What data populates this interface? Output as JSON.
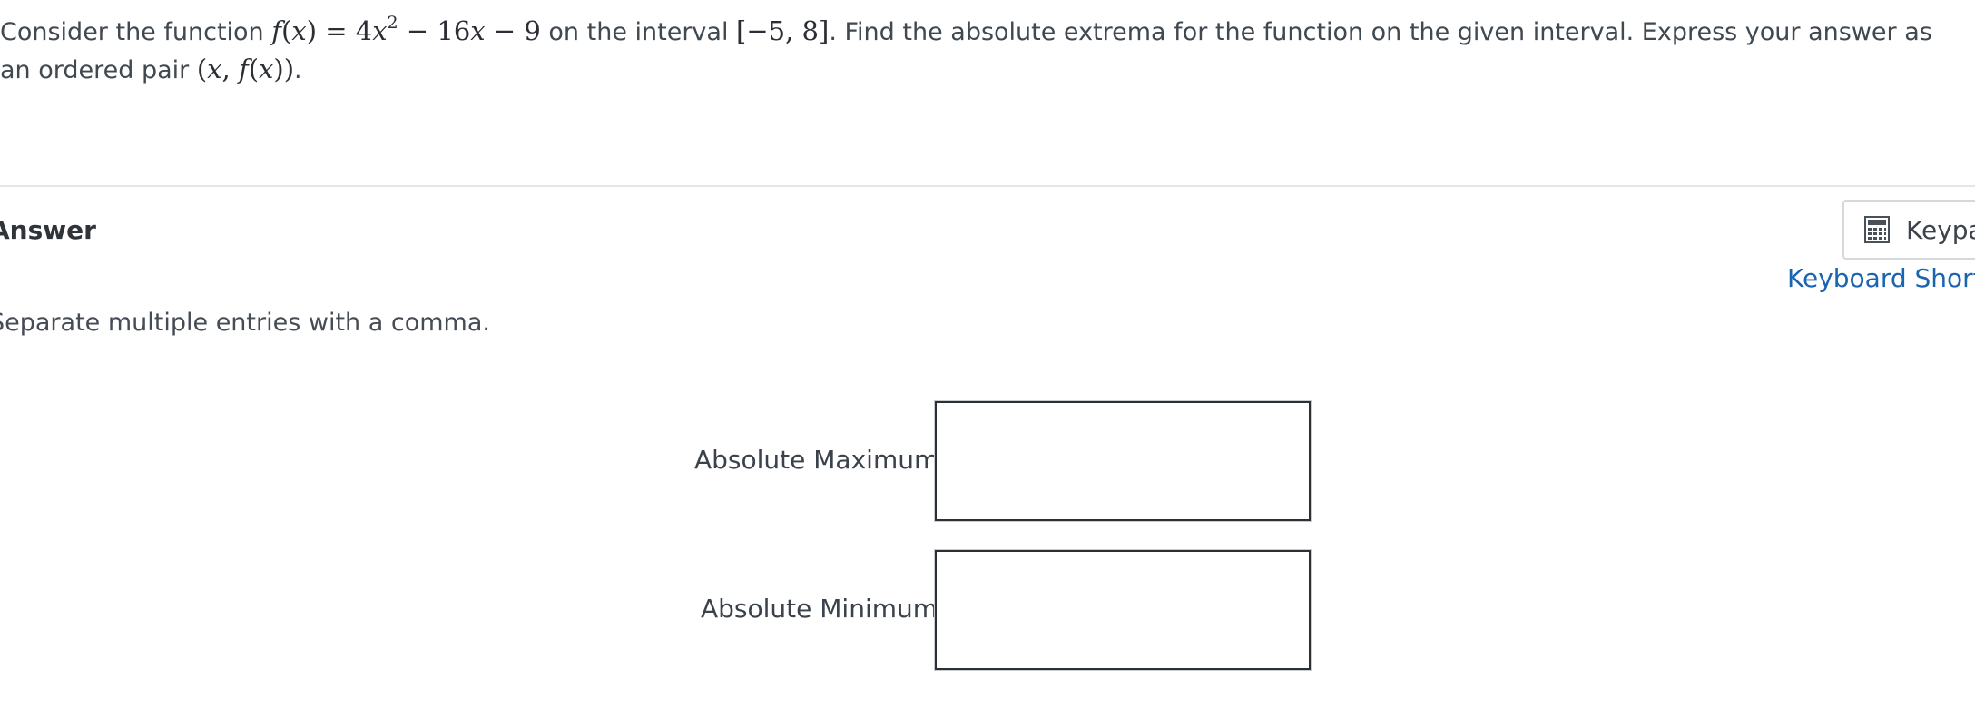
{
  "question": {
    "text_before": "Consider the function ",
    "function_expr": "f(x) = 4x² − 16x − 9",
    "text_middle": " on the interval ",
    "interval": "[−5, 8]",
    "text_after": ". Find the absolute extrema for the function on the given interval. Express your answer as an ordered pair ",
    "pair": "(x, f(x))",
    "text_end": "."
  },
  "answer": {
    "heading": "Answer",
    "instructions": "Separate multiple entries with a comma."
  },
  "keypad": {
    "label": "Keypad",
    "icon": "calculator-icon"
  },
  "shortcuts": {
    "label": "Keyboard Shortcuts"
  },
  "fields": {
    "max_label": "Absolute Maximum:",
    "max_value": "",
    "min_label": "Absolute Minimum:",
    "min_value": ""
  }
}
